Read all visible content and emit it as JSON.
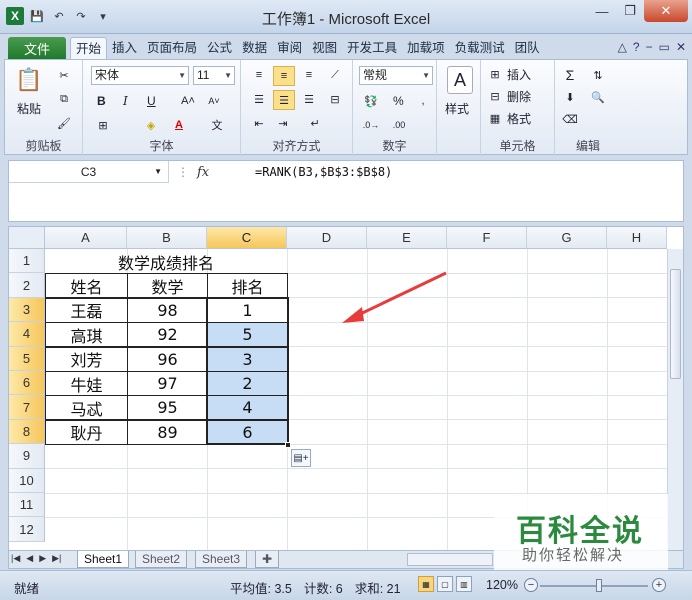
{
  "window": {
    "title": "工作簿1 - Microsoft Excel",
    "buttons": {
      "minimize": "—",
      "restore": "❐",
      "close": "✕"
    }
  },
  "ribbon_tabs": {
    "file": "文件",
    "items": [
      "开始",
      "插入",
      "页面布局",
      "公式",
      "数据",
      "审阅",
      "视图",
      "开发工具",
      "加载项",
      "负载测试",
      "团队"
    ],
    "active": "开始"
  },
  "ribbon": {
    "clipboard": {
      "label": "剪贴板",
      "paste": "粘贴"
    },
    "font": {
      "label": "字体",
      "name": "宋体",
      "size": "11",
      "bold": "B",
      "italic": "I",
      "underline": "U"
    },
    "alignment": {
      "label": "对齐方式"
    },
    "number": {
      "label": "数字",
      "format": "常规",
      "percent": "%"
    },
    "styles": {
      "label": "样式"
    },
    "cells": {
      "label": "单元格",
      "insert": "插入",
      "delete": "删除",
      "format": "格式"
    },
    "editing": {
      "label": "编辑"
    }
  },
  "formula_bar": {
    "name_box": "C3",
    "fx": "fx",
    "formula": "=RANK(B3,$B$3:$B$8)"
  },
  "sheet": {
    "columns": [
      "A",
      "B",
      "C",
      "D",
      "E",
      "F",
      "G",
      "H"
    ],
    "rows": [
      "1",
      "2",
      "3",
      "4",
      "5",
      "6",
      "7",
      "8",
      "9",
      "10",
      "11",
      "12"
    ],
    "title": "数学成绩排名",
    "headers": [
      "姓名",
      "数学",
      "排名"
    ],
    "data": [
      [
        "王磊",
        "98",
        "1"
      ],
      [
        "高琪",
        "92",
        "5"
      ],
      [
        "刘芳",
        "96",
        "3"
      ],
      [
        "牛娃",
        "97",
        "2"
      ],
      [
        "马忒",
        "95",
        "4"
      ],
      [
        "耿丹",
        "89",
        "6"
      ]
    ],
    "selected_cell": "C3"
  },
  "sheet_tabs": [
    "Sheet1",
    "Sheet2",
    "Sheet3"
  ],
  "status": {
    "mode": "就绪",
    "average": "平均值: 3.5",
    "count": "计数: 6",
    "sum": "求和: 21",
    "zoom": "120%"
  },
  "watermark": {
    "big": "百科全说",
    "small": "助你轻松解决"
  },
  "colors": {
    "accent_green": "#1f7a2b",
    "selection_fill": "#c6ddf5",
    "arrow": "#e83b3b"
  }
}
